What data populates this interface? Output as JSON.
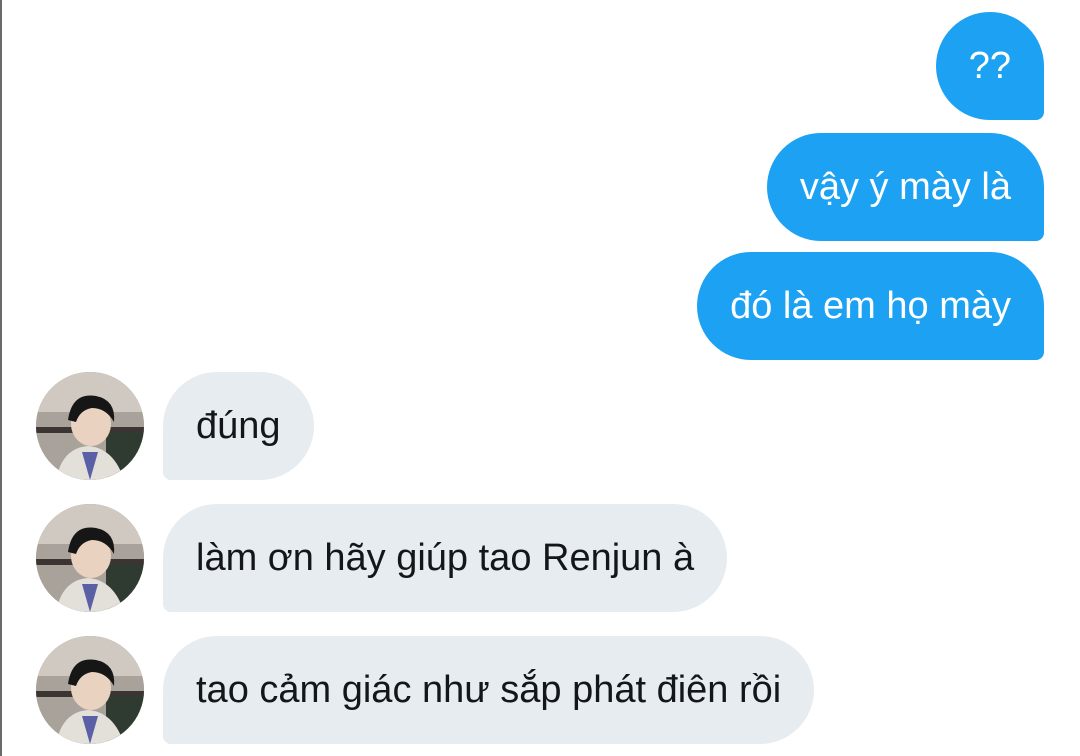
{
  "conversation": {
    "messages": [
      {
        "direction": "sent",
        "text": "??"
      },
      {
        "direction": "sent",
        "text": "vậy ý mày là"
      },
      {
        "direction": "sent",
        "text": "đó là em họ mày"
      },
      {
        "direction": "received",
        "text": "đúng"
      },
      {
        "direction": "received",
        "text": "làm ơn hãy giúp tao Renjun à"
      },
      {
        "direction": "received",
        "text": "tao cảm giác như sắp phát điên rồi"
      }
    ]
  },
  "colors": {
    "sent_bubble": "#1da1f2",
    "received_bubble": "#e6ecf0",
    "sent_text": "#ffffff",
    "received_text": "#14171a"
  },
  "icons": {
    "avatar": "user-avatar-photo"
  }
}
